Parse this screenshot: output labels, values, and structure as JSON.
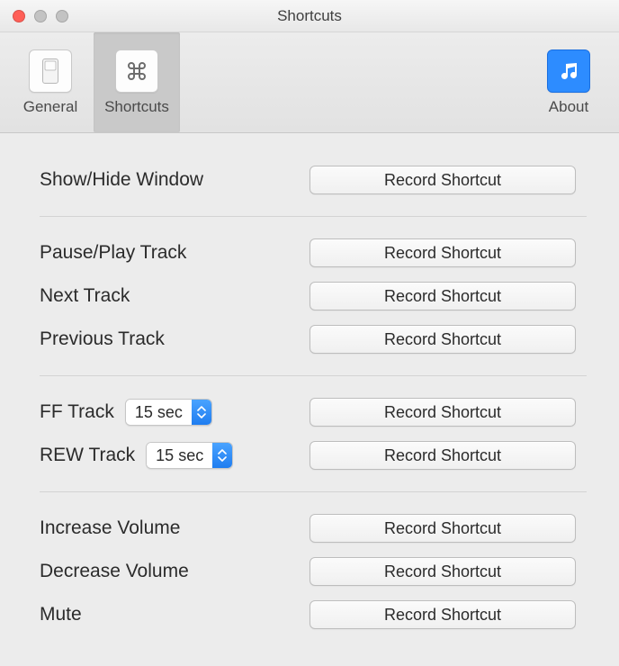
{
  "window": {
    "title": "Shortcuts"
  },
  "toolbar": {
    "general": {
      "label": "General"
    },
    "shortcuts": {
      "label": "Shortcuts"
    },
    "about": {
      "label": "About"
    }
  },
  "buttons": {
    "record": "Record Shortcut"
  },
  "selects": {
    "ff": {
      "value": "15 sec"
    },
    "rew": {
      "value": "15 sec"
    }
  },
  "rows": {
    "showhide": {
      "label": "Show/Hide Window"
    },
    "pauseplay": {
      "label": "Pause/Play Track"
    },
    "next": {
      "label": "Next Track"
    },
    "previous": {
      "label": "Previous Track"
    },
    "ff": {
      "label": "FF Track"
    },
    "rew": {
      "label": "REW Track"
    },
    "incvol": {
      "label": "Increase Volume"
    },
    "decvol": {
      "label": "Decrease Volume"
    },
    "mute": {
      "label": "Mute"
    }
  }
}
